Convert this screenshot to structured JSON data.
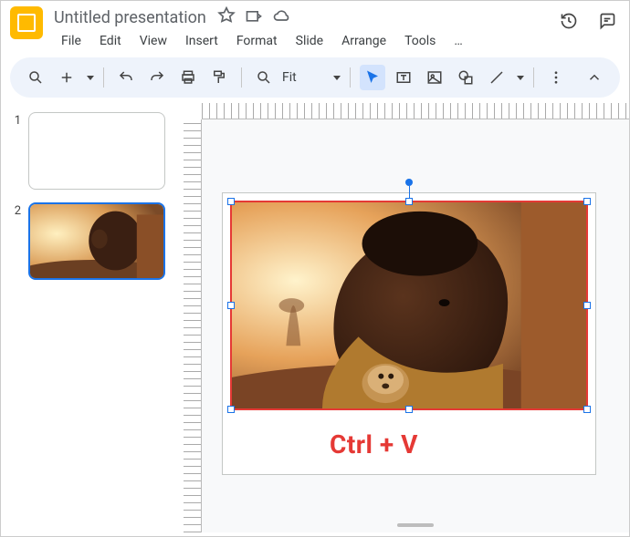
{
  "header": {
    "doc_title": "Untitled presentation",
    "menus": [
      "File",
      "Edit",
      "View",
      "Insert",
      "Format",
      "Slide",
      "Arrange",
      "Tools",
      "…"
    ]
  },
  "toolbar": {
    "zoom_label": "Fit"
  },
  "thumbs": [
    {
      "num": "1",
      "selected": false,
      "has_image": false
    },
    {
      "num": "2",
      "selected": true,
      "has_image": true
    }
  ],
  "annotation": "Ctrl + V"
}
